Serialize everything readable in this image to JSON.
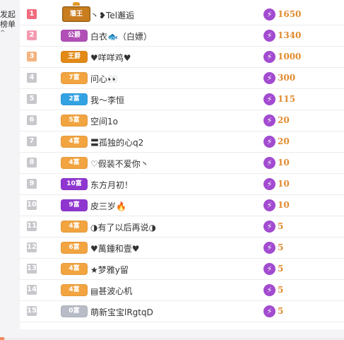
{
  "sidebar": {
    "label": "发起\n榜单",
    "caret": "^"
  },
  "colors": {
    "rank_top": "#f26a7e",
    "rank_2": "#f39ab0",
    "rank_3": "#f3b37f",
    "rank_default": "#c7c7cc",
    "score": "#e08a2e",
    "score_icon": "#a24bd0"
  },
  "rows": [
    {
      "rank": "1",
      "badge": "藩王",
      "badge_color": "#c97d1e",
      "name": "丶❥Tel邂逅",
      "score": "1650"
    },
    {
      "rank": "2",
      "badge": "公爵",
      "badge_color": "#b14fb7",
      "name": "白衣🐟（白嫖）",
      "score": "1340"
    },
    {
      "rank": "3",
      "badge": "王爵",
      "badge_color": "#e38a16",
      "name": "♥咩咩鸡♥",
      "score": "1000"
    },
    {
      "rank": "4",
      "badge": "7富",
      "badge_color": "#f2a440",
      "name": "问心👀",
      "score": "300"
    },
    {
      "rank": "5",
      "badge": "2富",
      "badge_color": "#33a2e2",
      "name": "我～李恒",
      "score": "115"
    },
    {
      "rank": "6",
      "badge": "5富",
      "badge_color": "#f2a440",
      "name": "空间1o",
      "score": "20"
    },
    {
      "rank": "7",
      "badge": "4富",
      "badge_color": "#f2a440",
      "name": "〓孤独的心q2",
      "score": "20"
    },
    {
      "rank": "8",
      "badge": "4富",
      "badge_color": "#f2a440",
      "name": "♡假装不爱你丶",
      "score": "10"
    },
    {
      "rank": "9",
      "badge": "10富",
      "badge_color": "#8f36d0",
      "name": "东方月初！",
      "score": "10"
    },
    {
      "rank": "10",
      "badge": "9富",
      "badge_color": "#8f36d0",
      "name": "皮三岁🔥",
      "score": "10"
    },
    {
      "rank": "11",
      "badge": "4富",
      "badge_color": "#f2a440",
      "name": "◑有了以后再说◑",
      "score": "5"
    },
    {
      "rank": "12",
      "badge": "6富",
      "badge_color": "#f2a440",
      "name": "♥萬鍾和壹♥",
      "score": "5"
    },
    {
      "rank": "13",
      "badge": "4富",
      "badge_color": "#f2a440",
      "name": "★梦雅y留",
      "score": "5"
    },
    {
      "rank": "14",
      "badge": "4富",
      "badge_color": "#f2a440",
      "name": "▤甚波心机",
      "score": "5"
    },
    {
      "rank": "15",
      "badge": "0富",
      "badge_color": "#b8bcc6",
      "name": "萌新宝宝lRgtqD",
      "score": "5"
    }
  ]
}
